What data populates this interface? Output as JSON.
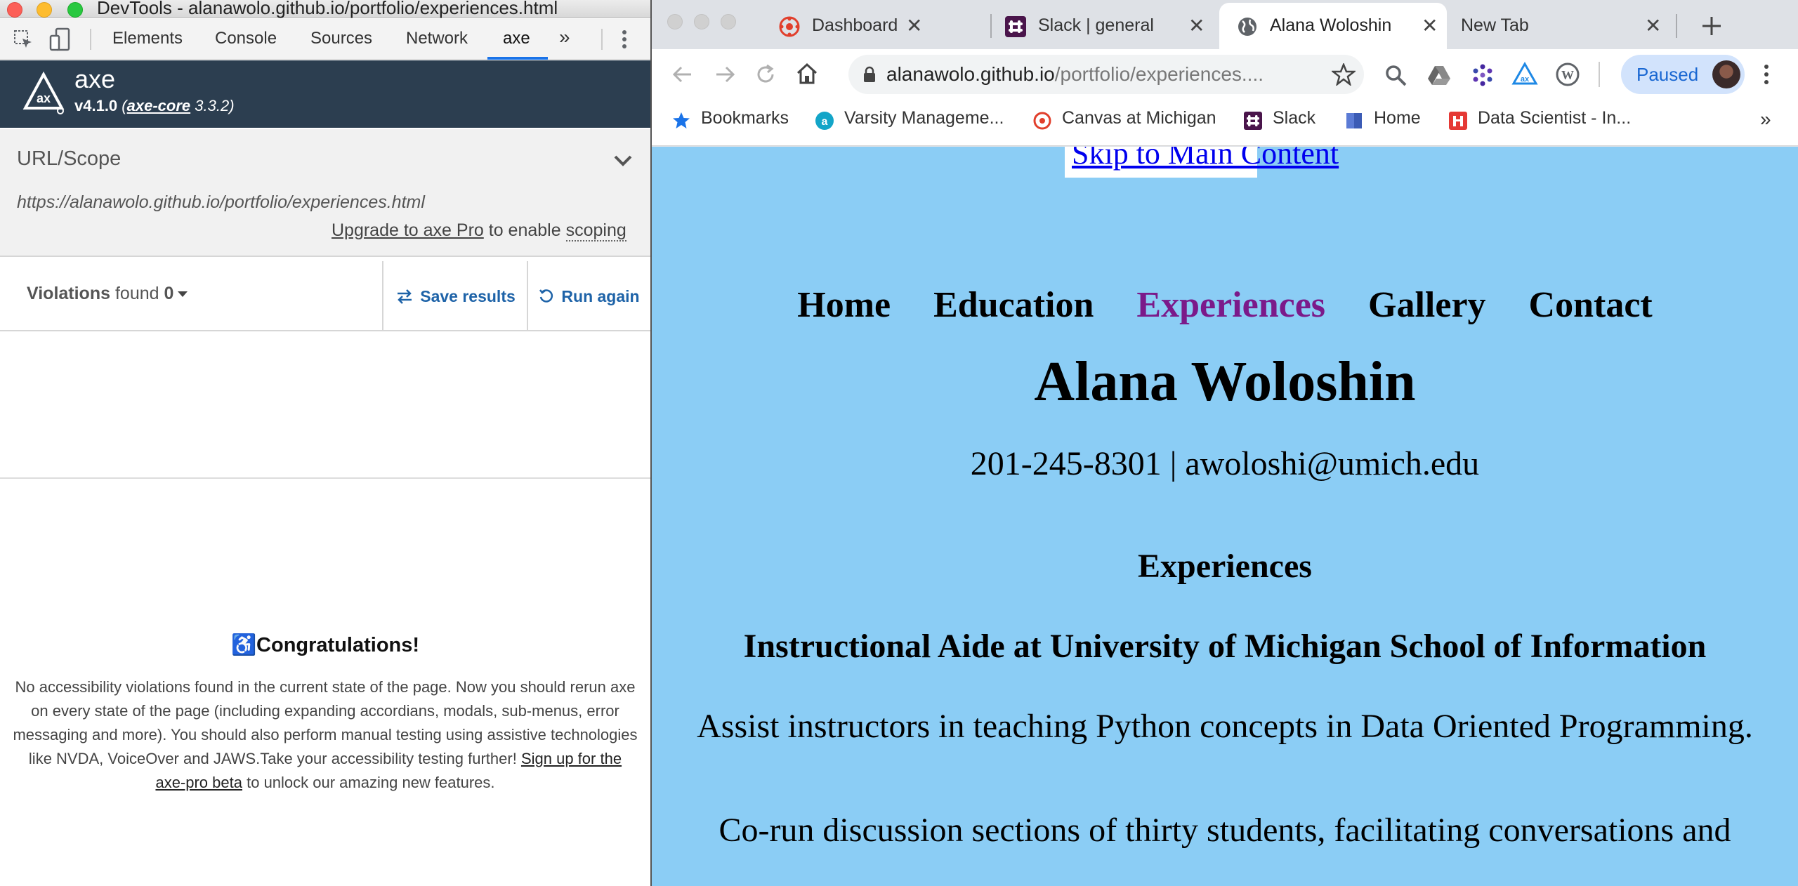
{
  "devtools": {
    "window_title": "DevTools - alanawolo.github.io/portfolio/experiences.html",
    "tabs": [
      "Elements",
      "Console",
      "Sources",
      "Network",
      "axe"
    ],
    "more_tabs": "»",
    "axe": {
      "name": "axe",
      "version": "v4.1.0",
      "core_label": "axe-core",
      "core_version": "3.3.2"
    },
    "scope": {
      "label": "URL/Scope",
      "url": "https://alanawolo.github.io/portfolio/experiences.html",
      "upgrade_link": "Upgrade to axe Pro",
      "upgrade_text": "to enable",
      "scoping": "scoping"
    },
    "violations": {
      "label": "Violations",
      "found": "found",
      "count": "0"
    },
    "buttons": {
      "save": "Save results",
      "run": "Run again"
    },
    "congrats": {
      "title": "Congratulations!",
      "body": "No accessibility violations found in the current state of the page. Now you should rerun axe on every state of the page (including expanding accordians, modals, sub-menus, error messaging and more). You should also perform manual testing using assistive technologies like NVDA, VoiceOver and JAWS.Take your accessibility testing further!",
      "link": "Sign up for the axe-pro beta",
      "tail": "to unlock our amazing new features."
    }
  },
  "browser": {
    "tabs": [
      {
        "label": "Dashboard",
        "icon": "canvas-icon"
      },
      {
        "label": "Slack | general | S",
        "icon": "slack-icon"
      },
      {
        "label": "Alana Woloshin",
        "icon": "globe-icon",
        "active": true
      },
      {
        "label": "New Tab",
        "icon": ""
      }
    ],
    "omnibox": {
      "host": "alanawolo.github.io",
      "path": "/portfolio/experiences...."
    },
    "profile_label": "Paused",
    "bookmarks": [
      {
        "label": "Bookmarks",
        "icon": "star-icon"
      },
      {
        "label": "Varsity Manageme...",
        "icon": "varsity-icon"
      },
      {
        "label": "Canvas at Michigan",
        "icon": "canvas-icon"
      },
      {
        "label": "Slack",
        "icon": "slack-icon"
      },
      {
        "label": "Home",
        "icon": "home-doc-icon"
      },
      {
        "label": "Data Scientist - In...",
        "icon": "indeed-icon"
      }
    ],
    "colors": {
      "page_bg": "#8bcdf5",
      "nav_current": "#7b1a8a",
      "axe_header": "#2c3e50",
      "link_blue": "#1e63a8"
    }
  },
  "site": {
    "skip_link": "Skip to Main Content",
    "nav": [
      "Home",
      "Education",
      "Experiences",
      "Gallery",
      "Contact"
    ],
    "nav_current": "Experiences",
    "name": "Alana Woloshin",
    "contact": "201-245-8301 | awoloshi@umich.edu",
    "section_title": "Experiences",
    "job_title": "Instructional Aide at University of Michigan School of Information",
    "job_p1": "Assist instructors in teaching Python concepts in Data Oriented Programming.",
    "job_p2": "Co-run discussion sections of thirty students, facilitating conversations and"
  }
}
